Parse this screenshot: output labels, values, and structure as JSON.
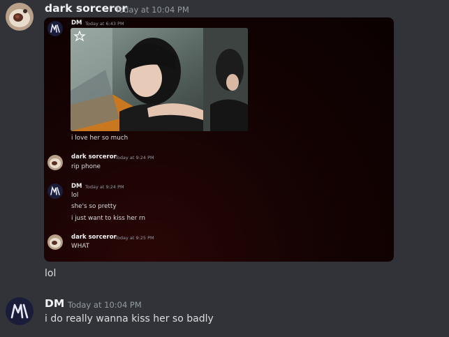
{
  "main_message": {
    "username": "dark sorceror",
    "timestamp": "Today at 10:04 PM",
    "followup_text": "lol"
  },
  "screenshot_embed": {
    "messages": [
      {
        "username": "DM",
        "timestamp": "Today at 6:43 PM",
        "text": "i love her so much"
      },
      {
        "username": "dark sorceror",
        "timestamp": "Today at 9:24 PM",
        "text": "rip phone"
      },
      {
        "username": "DM",
        "timestamp": "Today at 9:24 PM",
        "lines": [
          "lol",
          "she's so pretty",
          "i just want to kiss her rn"
        ]
      },
      {
        "username": "dark sorceror",
        "timestamp": "Today at 9:25 PM",
        "text": "WHAT"
      }
    ],
    "image_icon": "star-icon"
  },
  "reply_message": {
    "username": "DM",
    "timestamp": "Today at 10:04 PM",
    "text": "i do really wanna kiss her so badly"
  },
  "colors": {
    "background": "#313338",
    "username": "#f2f3f5",
    "timestamp": "#949ba4",
    "text": "#dbdee1",
    "embed_background": "#160303",
    "dm_avatar": "#1a1d3a"
  }
}
